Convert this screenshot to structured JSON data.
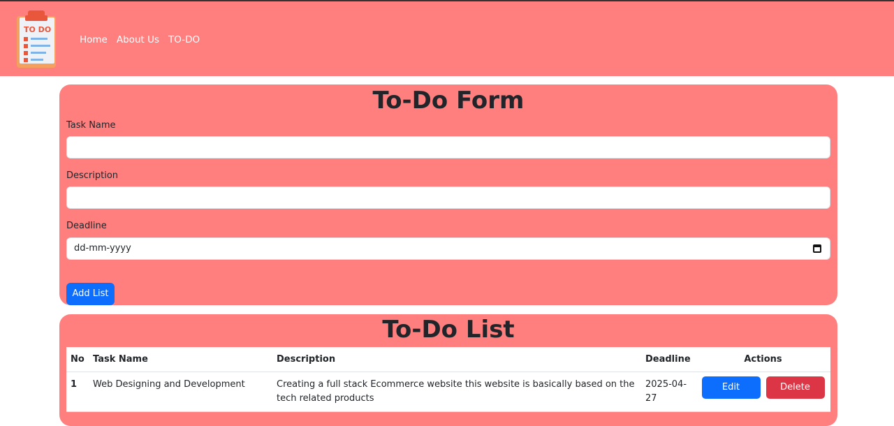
{
  "navbar": {
    "logo_text": "TO DO",
    "links": [
      "Home",
      "About Us",
      "TO-DO"
    ]
  },
  "form": {
    "title": "To-Do Form",
    "task_label": "Task Name",
    "task_value": "",
    "description_label": "Description",
    "description_value": "",
    "deadline_label": "Deadline",
    "deadline_placeholder": "dd-mm-yyyy",
    "add_button": "Add List"
  },
  "list": {
    "title": "To-Do List",
    "headers": [
      "No",
      "Task Name",
      "Description",
      "Deadline",
      "Actions"
    ],
    "rows": [
      {
        "no": "1",
        "task": "Web Designing and Development",
        "description": "Creating a full stack Ecommerce website this website is basically based on the tech related products",
        "deadline": "2025-04-27",
        "edit": "Edit",
        "delete": "Delete"
      }
    ]
  },
  "colors": {
    "accent": "#ff7f7f",
    "primary": "#0d6efd",
    "danger": "#dc3545"
  }
}
